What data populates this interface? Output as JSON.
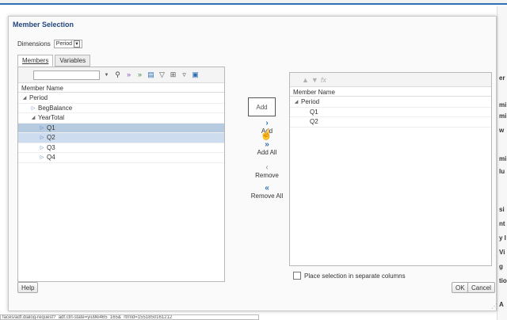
{
  "dialog": {
    "title": "Member Selection",
    "dimensions_label": "Dimensions",
    "dimension_value": "Period"
  },
  "tabs": [
    {
      "label": "Members",
      "active": true
    },
    {
      "label": "Variables",
      "active": false
    }
  ],
  "left_grid": {
    "header": "Member Name",
    "rows": [
      {
        "label": "Period",
        "level": 0,
        "expanded": true,
        "state": "none"
      },
      {
        "label": "BegBalance",
        "level": 1,
        "expanded": false,
        "state": "none"
      },
      {
        "label": "YearTotal",
        "level": 1,
        "expanded": true,
        "state": "none"
      },
      {
        "label": "Q1",
        "level": 2,
        "expanded": false,
        "state": "selected"
      },
      {
        "label": "Q2",
        "level": 2,
        "expanded": false,
        "state": "selected-light"
      },
      {
        "label": "Q3",
        "level": 2,
        "expanded": false,
        "state": "none"
      },
      {
        "label": "Q4",
        "level": 2,
        "expanded": false,
        "state": "none"
      }
    ]
  },
  "shuttle": {
    "add_box": "Add",
    "add": "Add",
    "add_all": "Add All",
    "remove": "Remove",
    "remove_all": "Remove All"
  },
  "right_grid": {
    "header": "Member Name",
    "rows": [
      {
        "label": "Period",
        "level": 0,
        "expanded": true
      },
      {
        "label": "Q1",
        "level": 1,
        "expanded": false
      },
      {
        "label": "Q2",
        "level": 1,
        "expanded": false
      }
    ]
  },
  "separate_columns_label": "Place selection in separate columns",
  "buttons": {
    "help": "Help",
    "ok": "OK",
    "cancel": "Cancel"
  },
  "status_url": "faces/adf.dialog-request?_adf.ctrl-state=yiu9ki465_165&_rtrnId=1551850161212",
  "background_fragments": [
    "er",
    "mi",
    "mi",
    "w",
    "mi",
    "lu",
    "si",
    "nt",
    "y I",
    "Vi",
    "g",
    "tio",
    "A"
  ],
  "colors": {
    "title": "#24477e",
    "selection": "#b7cbe0",
    "accent": "#2f6fb4"
  }
}
